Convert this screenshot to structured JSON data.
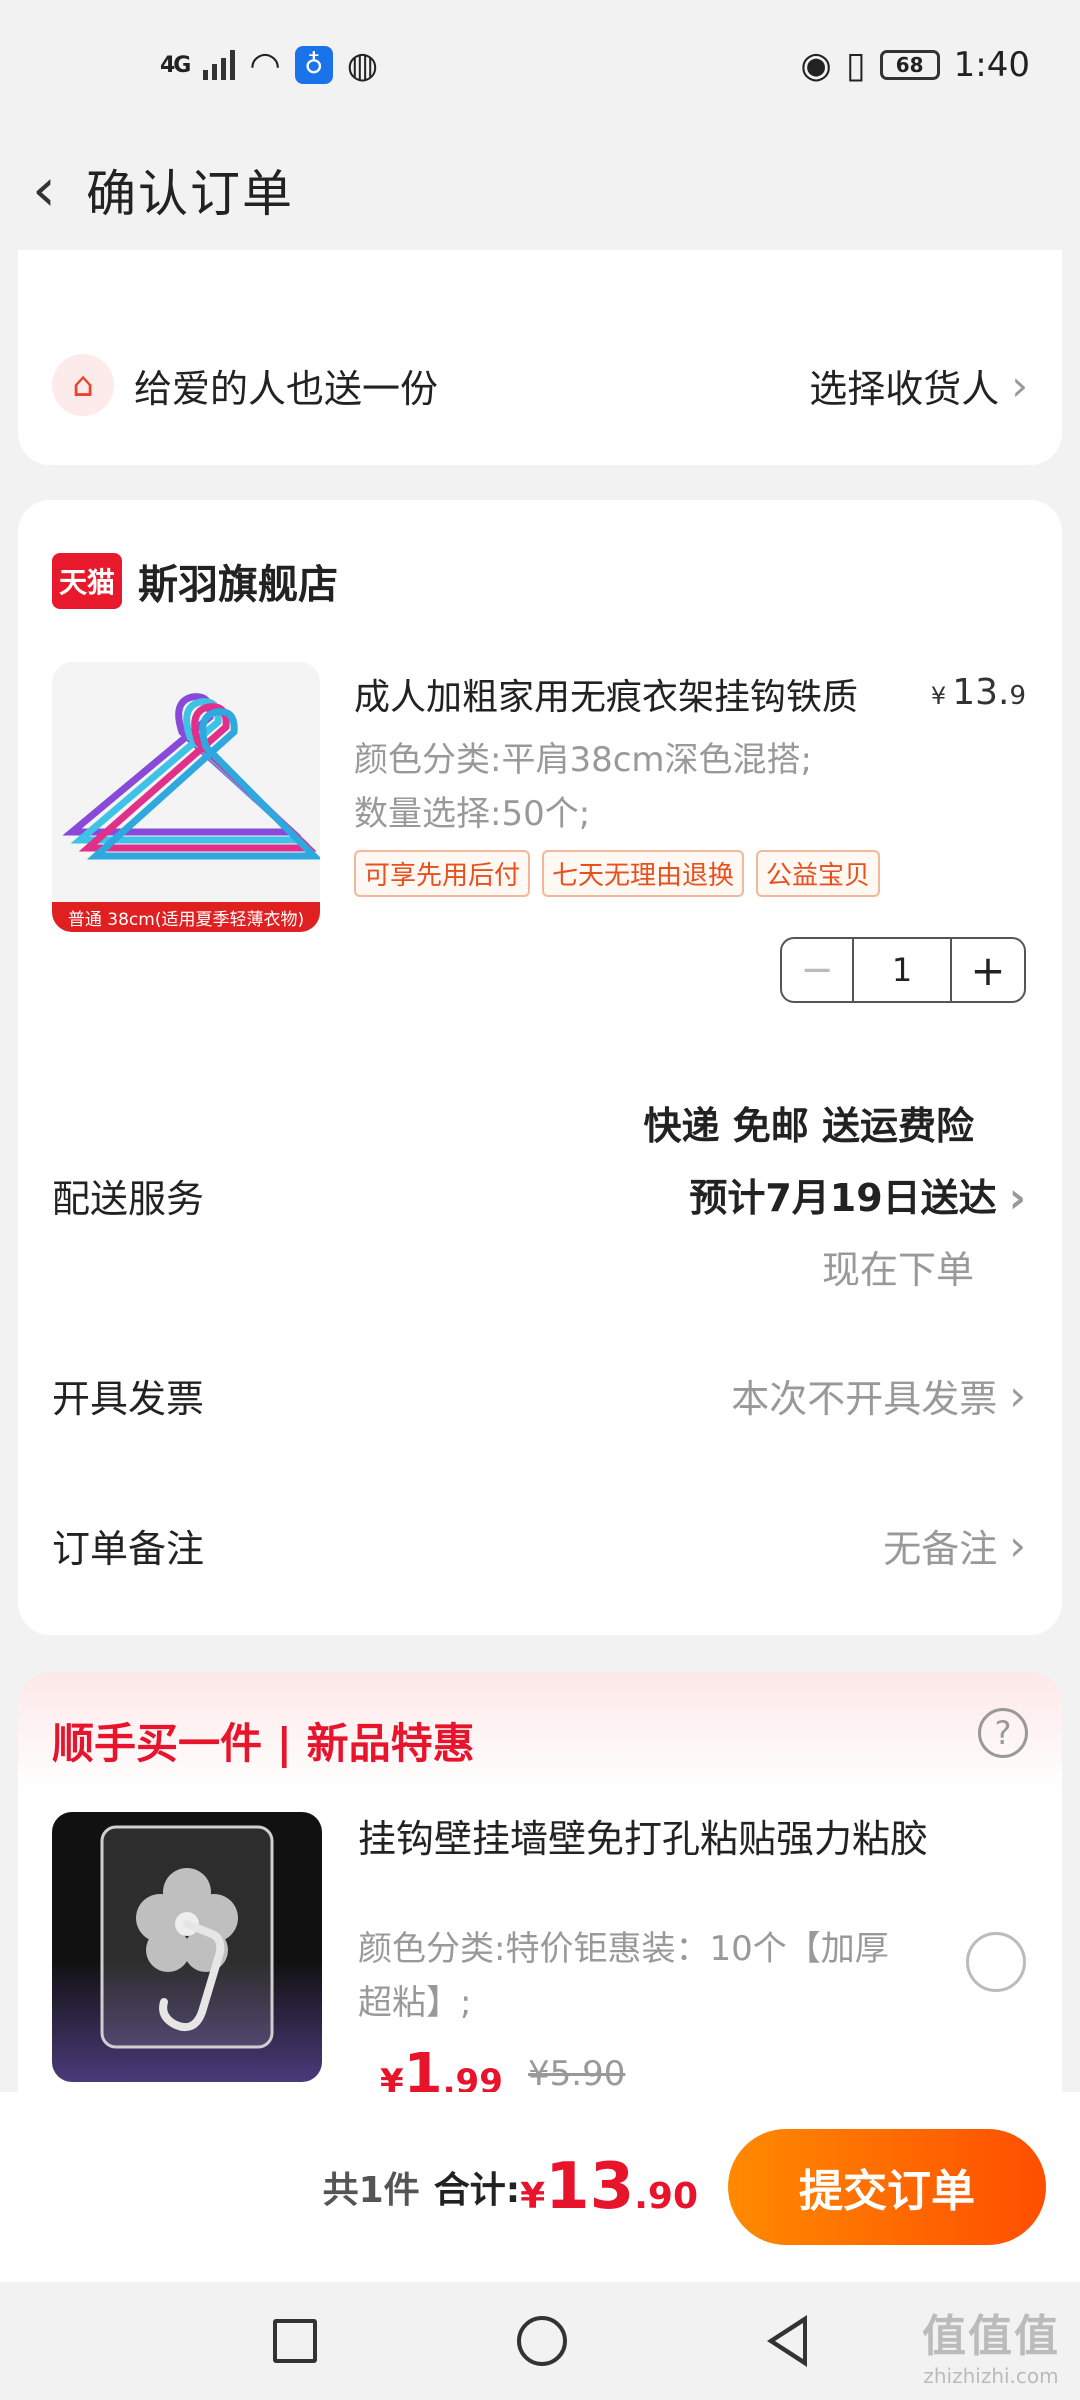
{
  "status_bar": {
    "network": "4G",
    "time": "1:40",
    "battery": "68",
    "icons": [
      "signal-icon",
      "wifi-icon",
      "bulb-icon",
      "ball-icon",
      "eye-icon",
      "vibrate-icon",
      "battery-icon"
    ]
  },
  "nav": {
    "title": "确认订单",
    "back_icon": "chevron-left-icon"
  },
  "gift": {
    "label": "给爱的人也送一份",
    "action": "选择收货人",
    "icon": "gift-icon"
  },
  "shop": {
    "badge": "天猫",
    "name": "斯羽旗舰店",
    "product": {
      "title": "成人加粗家用无痕衣架挂钩铁质",
      "price_symbol": "¥",
      "price_int": "13.",
      "price_dec": "9",
      "spec_color": "颜色分类:平肩38cm深色混搭;",
      "spec_qty": "数量选择:50个;",
      "tags": [
        "可享先用后付",
        "七天无理由退换",
        "公益宝贝"
      ],
      "image_caption": "普通 38cm(适用夏季轻薄衣物)",
      "quantity": "1",
      "minus": "−",
      "plus": "+"
    },
    "delivery": {
      "label": "配送服务",
      "line1": "快递 免邮 送运费险",
      "line2": "预计7月19日送达",
      "line3": "现在下单"
    },
    "invoice": {
      "label": "开具发票",
      "value": "本次不开具发票"
    },
    "note": {
      "label": "订单备注",
      "value": "无备注"
    }
  },
  "promo": {
    "title": "顺手买一件 | 新品特惠",
    "help": "?",
    "item": {
      "name": "挂钩壁挂墙壁免打孔粘贴强力粘胶",
      "spec": "颜色分类:特价钜惠装：10个【加厚超粘】;",
      "price_symbol": "¥",
      "price_int": "1",
      "price_dec": ".99",
      "old_price": "¥5.90"
    }
  },
  "bottom": {
    "count": "共1件",
    "total_label": "合计:",
    "total_symbol": "¥",
    "total_int": "13",
    "total_dec": ".90",
    "submit": "提交订单"
  },
  "watermark": {
    "big": "值值值",
    "small": "zhizhizhi.com"
  },
  "colors": {
    "accent": "#ff5a00",
    "price_red": "#e8142c",
    "tmall_red": "#e8192c"
  }
}
